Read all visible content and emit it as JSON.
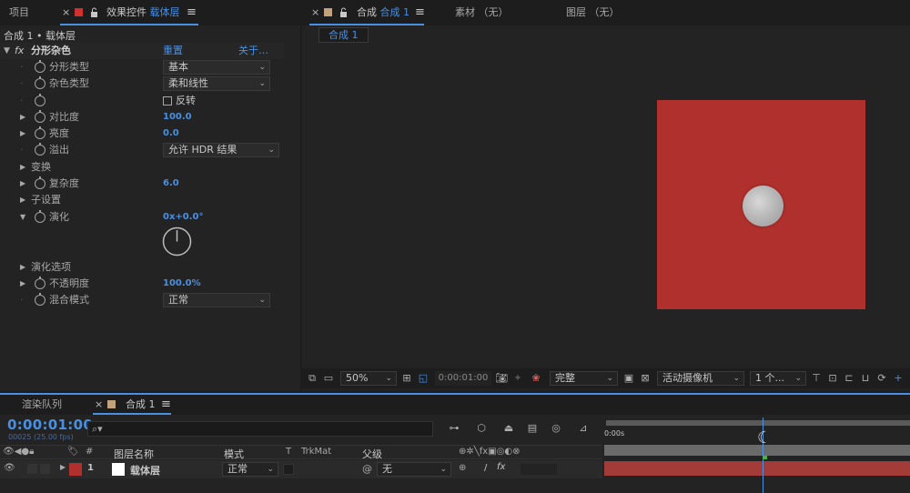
{
  "left_panel": {
    "tab_project": "项目",
    "tab_effects_prefix": "效果控件",
    "tab_effects_layer": "载体层",
    "breadcrumb": "合成 1 • 载体层",
    "effect_name": "分形杂色",
    "reset": "重置",
    "about": "关于…",
    "props": [
      {
        "label": "分形类型",
        "value": "基本"
      },
      {
        "label": "杂色类型",
        "value": "柔和线性"
      },
      {
        "label": "",
        "value": "反转"
      },
      {
        "label": "对比度",
        "value": "100.0"
      },
      {
        "label": "亮度",
        "value": "0.0"
      },
      {
        "label": "溢出",
        "value": "允许 HDR 结果"
      },
      {
        "label": "变换",
        "value": ""
      },
      {
        "label": "复杂度",
        "value": "6.0"
      },
      {
        "label": "子设置",
        "value": ""
      },
      {
        "label": "演化",
        "value": "0x+0.0°"
      },
      {
        "label": "演化选项",
        "value": ""
      },
      {
        "label": "不透明度",
        "value": "100.0%"
      },
      {
        "label": "混合模式",
        "value": "正常"
      }
    ]
  },
  "viewer": {
    "tab_comp_prefix": "合成",
    "tab_comp_name": "合成 1",
    "tab_footage": "素材 （无）",
    "tab_layer": "图层 （无）",
    "sub_tab": "合成 1",
    "solid_color": "#b0302d",
    "toolbar": {
      "zoom": "50%",
      "timecode": "0:00:01:00",
      "resolution": "完整",
      "camera": "活动摄像机",
      "views": "1 个..."
    }
  },
  "timeline": {
    "tab_render": "渲染队列",
    "tab_comp": "合成 1",
    "timecode": "0:00:01:00",
    "frame_info": "00025 (25.00 fps)",
    "search_placeholder": "",
    "col_num": "#",
    "col_layer_name": "图层名称",
    "col_mode": "模式",
    "col_t": "T",
    "col_trkmat": "TrkMat",
    "col_parent": "父级",
    "layer": {
      "num": "1",
      "name": "载体层",
      "mode": "正常",
      "parent": "无",
      "label_color": "#b0302d"
    },
    "ruler_start": "0:00s"
  }
}
